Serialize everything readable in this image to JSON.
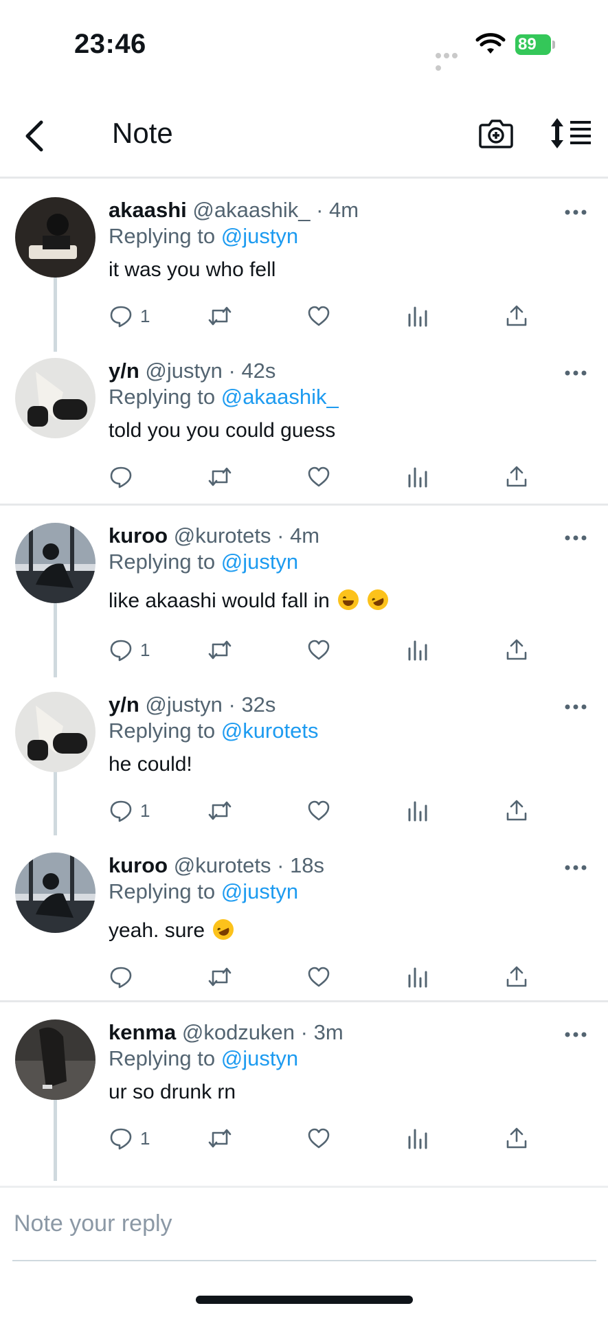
{
  "status_bar": {
    "time": "23:46",
    "battery": "89"
  },
  "nav": {
    "title": "Note"
  },
  "threads": [
    {
      "tweets": [
        {
          "name": "akaashi",
          "handle": "@akaashik_",
          "sep": " · ",
          "time": "4m",
          "replying_prefix": "Replying to ",
          "replying_to": "@justyn",
          "text": "it was you who fell",
          "reply_count": "1"
        },
        {
          "name": "y/n",
          "handle": "@justyn",
          "sep": " · ",
          "time": "42s",
          "replying_prefix": "Replying to ",
          "replying_to": "@akaashik_",
          "text": "told you you could guess",
          "reply_count": ""
        }
      ]
    },
    {
      "tweets": [
        {
          "name": "kuroo",
          "handle": "@kurotets",
          "sep": " · ",
          "time": "4m",
          "replying_prefix": "Replying to ",
          "replying_to": "@justyn",
          "text": "like akaashi would fall in",
          "reply_count": "1"
        },
        {
          "name": "y/n",
          "handle": "@justyn",
          "sep": " · ",
          "time": "32s",
          "replying_prefix": "Replying to ",
          "replying_to": "@kurotets",
          "text": "he could!",
          "reply_count": "1"
        },
        {
          "name": "kuroo",
          "handle": "@kurotets",
          "sep": " · ",
          "time": "18s",
          "replying_prefix": "Replying to ",
          "replying_to": "@justyn",
          "text": "yeah. sure",
          "reply_count": ""
        }
      ]
    },
    {
      "tweets": [
        {
          "name": "kenma",
          "handle": "@kodzuken",
          "sep": " · ",
          "time": "3m",
          "replying_prefix": "Replying to ",
          "replying_to": "@justyn",
          "text": "ur so drunk rn",
          "reply_count": "1"
        }
      ]
    }
  ],
  "reply": {
    "placeholder": "Note your reply"
  },
  "colors": {
    "link": "#1d9bf0",
    "muted": "#536471",
    "battery": "#34c759"
  },
  "icons": [
    "back-icon",
    "camera-plus-icon",
    "sort-icon",
    "more-icon",
    "reply-icon",
    "retweet-icon",
    "like-icon",
    "views-icon",
    "share-icon",
    "laughing-emoji-icon",
    "rofl-emoji-icon"
  ]
}
